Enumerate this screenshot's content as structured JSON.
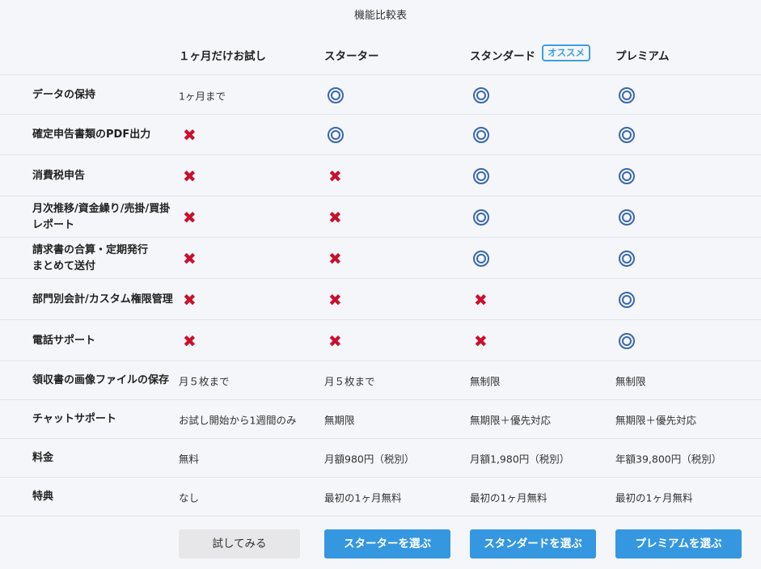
{
  "title": "機能比較表",
  "plans": [
    {
      "name": "１ヶ月だけお試し"
    },
    {
      "name": "スターター"
    },
    {
      "name": "スタンダード",
      "badge": "オススメ"
    },
    {
      "name": "プレミアム"
    }
  ],
  "rows": [
    {
      "label": "データの保持",
      "cells": [
        {
          "type": "text",
          "value": "1ヶ月まで"
        },
        {
          "type": "yes"
        },
        {
          "type": "yes"
        },
        {
          "type": "yes"
        }
      ]
    },
    {
      "label": "確定申告書類のPDF出力",
      "cells": [
        {
          "type": "no"
        },
        {
          "type": "yes"
        },
        {
          "type": "yes"
        },
        {
          "type": "yes"
        }
      ]
    },
    {
      "label": "消費税申告",
      "cells": [
        {
          "type": "no"
        },
        {
          "type": "no"
        },
        {
          "type": "yes"
        },
        {
          "type": "yes"
        }
      ]
    },
    {
      "label": "月次推移/資金繰り/売掛/買掛\nレポート",
      "cells": [
        {
          "type": "no"
        },
        {
          "type": "no"
        },
        {
          "type": "yes"
        },
        {
          "type": "yes"
        }
      ]
    },
    {
      "label": "請求書の合算・定期発行\nまとめて送付",
      "cells": [
        {
          "type": "no"
        },
        {
          "type": "no"
        },
        {
          "type": "yes"
        },
        {
          "type": "yes"
        }
      ]
    },
    {
      "label": "部門別会計/カスタム権限管理",
      "cells": [
        {
          "type": "no"
        },
        {
          "type": "no"
        },
        {
          "type": "no"
        },
        {
          "type": "yes"
        }
      ]
    },
    {
      "label": "電話サポート",
      "cells": [
        {
          "type": "no"
        },
        {
          "type": "no"
        },
        {
          "type": "no"
        },
        {
          "type": "yes"
        }
      ]
    },
    {
      "label": "領収書の画像ファイルの保存",
      "cells": [
        {
          "type": "text",
          "value": "月５枚まで"
        },
        {
          "type": "text",
          "value": "月５枚まで"
        },
        {
          "type": "text",
          "value": "無制限"
        },
        {
          "type": "text",
          "value": "無制限"
        }
      ]
    },
    {
      "label": "チャットサポート",
      "cells": [
        {
          "type": "text",
          "value": "お試し開始から1週間のみ"
        },
        {
          "type": "text",
          "value": "無期限"
        },
        {
          "type": "text",
          "value": "無期限＋優先対応"
        },
        {
          "type": "text",
          "value": "無期限＋優先対応"
        }
      ]
    },
    {
      "label": "料金",
      "cells": [
        {
          "type": "text",
          "value": "無料"
        },
        {
          "type": "text",
          "value": "月額980円（税別）"
        },
        {
          "type": "text",
          "value": "月額1,980円（税別）"
        },
        {
          "type": "text",
          "value": "年額39,800円（税別）"
        }
      ]
    },
    {
      "label": "特典",
      "cells": [
        {
          "type": "text",
          "value": "なし"
        },
        {
          "type": "text",
          "value": "最初の1ヶ月無料"
        },
        {
          "type": "text",
          "value": "最初の1ヶ月無料"
        },
        {
          "type": "text",
          "value": "最初の1ヶ月無料"
        }
      ]
    }
  ],
  "icons": {
    "yes": "double-circle-icon",
    "no": "cross-icon",
    "yes_color": "#3a67ad",
    "no_color": "#c8102e"
  },
  "buttons": [
    "試してみる",
    "スターターを選ぶ",
    "スタンダードを選ぶ",
    "プレミアムを選ぶ"
  ],
  "colors": {
    "accent": "#3597e0",
    "background": "#f5f6fa"
  }
}
